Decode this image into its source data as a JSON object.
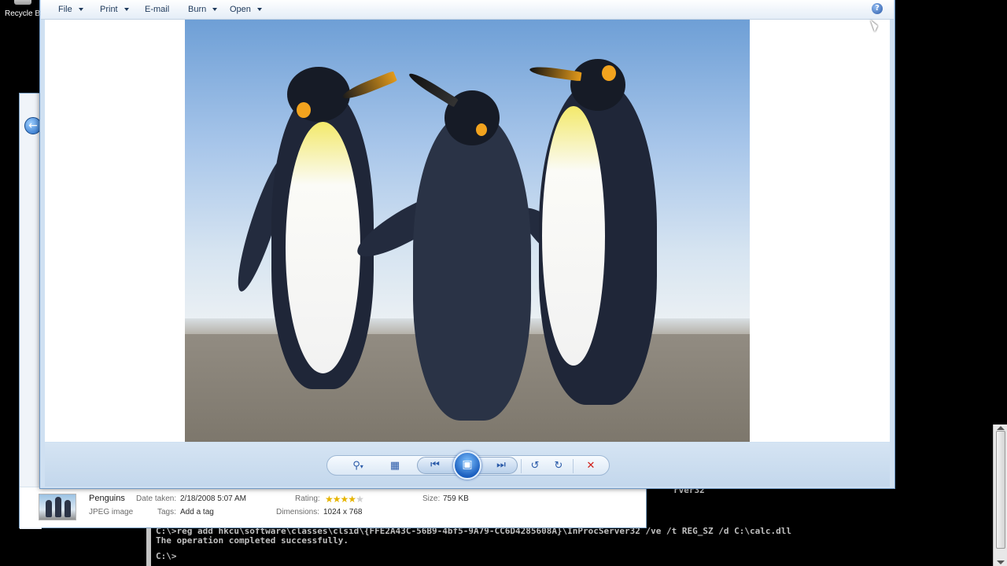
{
  "desktop": {
    "recycle_bin_label": "Recycle B"
  },
  "viewer": {
    "menu": [
      {
        "label": "File"
      },
      {
        "label": "Print"
      },
      {
        "label": "E-mail"
      },
      {
        "label": "Burn"
      },
      {
        "label": "Open"
      }
    ],
    "help_glyph": "?",
    "image_subject": "Penguins",
    "controls": {
      "zoom_icon": "magnifier-icon",
      "fit_icon": "actual-size-icon",
      "previous_icon": "previous-icon",
      "slideshow_icon": "slideshow-icon",
      "next_icon": "next-icon",
      "rotate_ccw_icon": "rotate-counterclockwise-icon",
      "rotate_cw_icon": "rotate-clockwise-icon",
      "delete_icon": "delete-icon"
    }
  },
  "details_pane": {
    "file_name": "Penguins",
    "file_type": "JPEG image",
    "date_taken_label": "Date taken:",
    "date_taken_value": "2/18/2008 5:07 AM",
    "tags_label": "Tags:",
    "tags_value": "Add a tag",
    "rating_label": "Rating:",
    "rating_stars_filled": 4,
    "rating_stars_total": 5,
    "dimensions_label": "Dimensions:",
    "dimensions_value": "1024 x 768",
    "size_label": "Size:",
    "size_value": "759 KB"
  },
  "console": {
    "lines": [
      "C:\\>reg add hkcu\\software\\classes\\clsid\\{FFE2A43C-56B9-4bf5-9A79-CC6D4285608A}\\InProcServer32 /ve /t REG_SZ /d C:\\calc.dll",
      "The operation completed successfully.",
      "",
      "C:\\>"
    ],
    "partial_text": "rver32"
  },
  "colors": {
    "accent": "#2a5aa8",
    "delete": "#d0201a",
    "star": "#e6b400"
  }
}
